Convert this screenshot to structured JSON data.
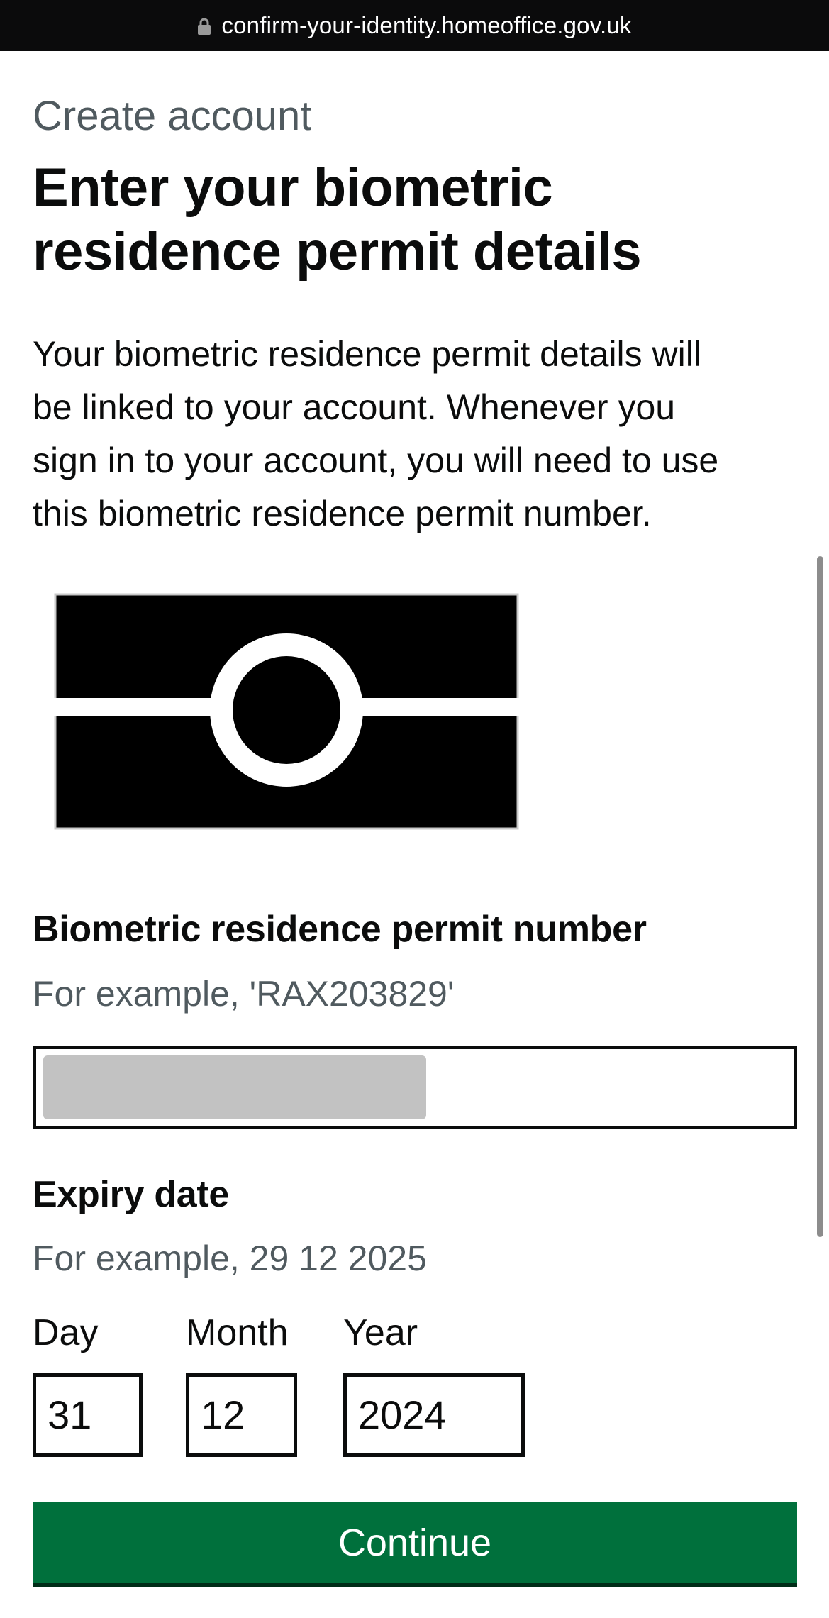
{
  "browser": {
    "url": "confirm-your-identity.homeoffice.gov.uk",
    "lock_icon": "lock-icon"
  },
  "page": {
    "caption": "Create account",
    "heading_line1": "Enter your biometric",
    "heading_line2": "residence permit details",
    "lead_line1": "Your biometric residence permit details will",
    "lead_line2": "be linked to your account. Whenever you",
    "lead_line3": "sign in to your account, you will need to use",
    "lead_line4": "this biometric residence permit number.",
    "illustration_icon": "biometric-chip-icon"
  },
  "permit_number": {
    "label": "Biometric residence permit number",
    "hint": "For example, 'RAX203829'",
    "value": ""
  },
  "expiry": {
    "label": "Expiry date",
    "hint": "For example, 29 12 2025",
    "day_label": "Day",
    "month_label": "Month",
    "year_label": "Year",
    "day_value": "31",
    "month_value": "12",
    "year_value": "2024"
  },
  "actions": {
    "continue_label": "Continue"
  },
  "colors": {
    "button_green": "#00703c",
    "text": "#0b0c0c",
    "secondary_text": "#505a5f",
    "url_bar": "#0b0b0c",
    "redaction": "#c2c2c2"
  }
}
